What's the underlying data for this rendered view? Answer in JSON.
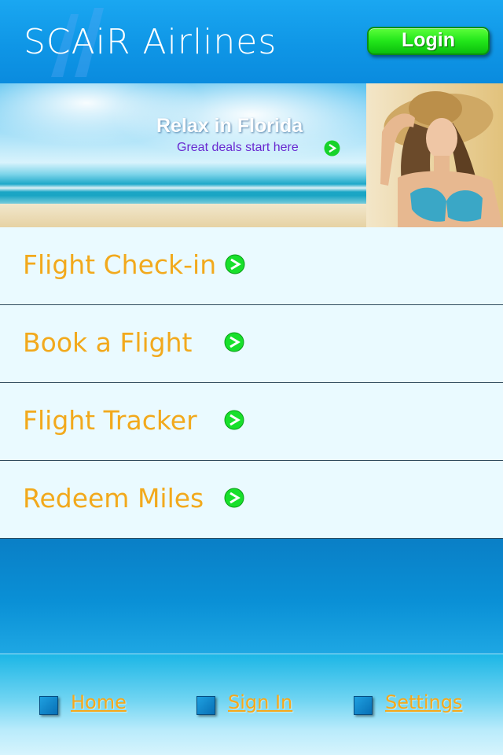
{
  "header": {
    "logo_text": "SCAiR Airlines",
    "login_label": "Login"
  },
  "banner": {
    "title": "Relax in Florida",
    "subtitle": "Great deals start here",
    "arrow_icon": "green-arrow-icon"
  },
  "menu": {
    "items": [
      {
        "label": "Flight Check-in",
        "icon": "green-arrow-icon"
      },
      {
        "label": "Book a Flight",
        "icon": "green-arrow-icon"
      },
      {
        "label": "Flight Tracker",
        "icon": "green-arrow-icon"
      },
      {
        "label": "Redeem Miles",
        "icon": "green-arrow-icon"
      }
    ]
  },
  "footer": {
    "links": [
      {
        "label": "Home",
        "icon": "blue-square-icon"
      },
      {
        "label": "Sign In",
        "icon": "blue-square-icon"
      },
      {
        "label": "Settings",
        "icon": "blue-square-icon"
      }
    ]
  },
  "colors": {
    "header_blue": "#0f96e6",
    "menu_text": "#f2a91c",
    "menu_bg": "#eafaff",
    "login_green": "#22e61a",
    "banner_subtitle": "#6a2ad0"
  }
}
